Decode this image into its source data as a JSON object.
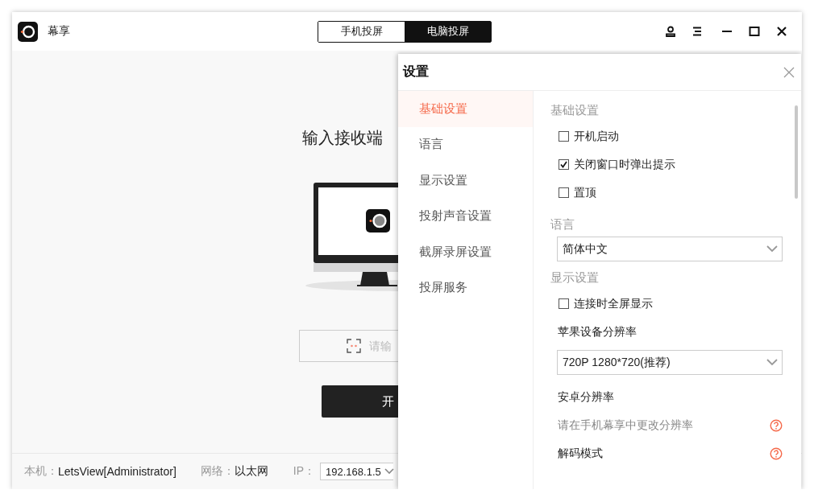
{
  "app": {
    "name": "幕享"
  },
  "mode_tabs": [
    {
      "label": "手机投屏",
      "selected": false
    },
    {
      "label": "电脑投屏",
      "selected": true
    }
  ],
  "main": {
    "heading": "输入接收端",
    "code_field": {
      "placeholder": "请输"
    },
    "start_button": "开"
  },
  "status_bar": {
    "device_label": "本机：",
    "device": "LetsView[Administrator]",
    "network_label": "网络：",
    "network": "以太网",
    "ip_label": "IP：",
    "ip": "192.168.1.5"
  },
  "settings": {
    "title": "设置",
    "nav": [
      {
        "label": "基础设置",
        "selected": true
      },
      {
        "label": "语言",
        "selected": false
      },
      {
        "label": "显示设置",
        "selected": false
      },
      {
        "label": "投射声音设置",
        "selected": false
      },
      {
        "label": "截屏录屏设置",
        "selected": false
      },
      {
        "label": "投屏服务",
        "selected": false
      }
    ],
    "sections": [
      {
        "heading": "基础设置",
        "items": [
          {
            "kind": "checkbox",
            "label": "开机启动",
            "checked": false
          },
          {
            "kind": "checkbox",
            "label": "关闭窗口时弹出提示",
            "checked": true
          },
          {
            "kind": "checkbox",
            "label": "置顶",
            "checked": false
          }
        ]
      },
      {
        "heading": "语言",
        "items": [
          {
            "kind": "select",
            "value": "简体中文"
          }
        ]
      },
      {
        "heading": "显示设置",
        "items": [
          {
            "kind": "checkbox",
            "label": "连接时全屏显示",
            "checked": false
          },
          {
            "kind": "label",
            "text": "苹果设备分辨率",
            "help": false
          },
          {
            "kind": "select",
            "value": "720P 1280*720(推荐)"
          },
          {
            "kind": "label",
            "text": "安卓分辨率",
            "help": false
          },
          {
            "kind": "hint",
            "text": "请在手机幕享中更改分辨率",
            "help": true
          },
          {
            "kind": "label",
            "text": "解码模式",
            "help": true
          }
        ]
      }
    ]
  }
}
